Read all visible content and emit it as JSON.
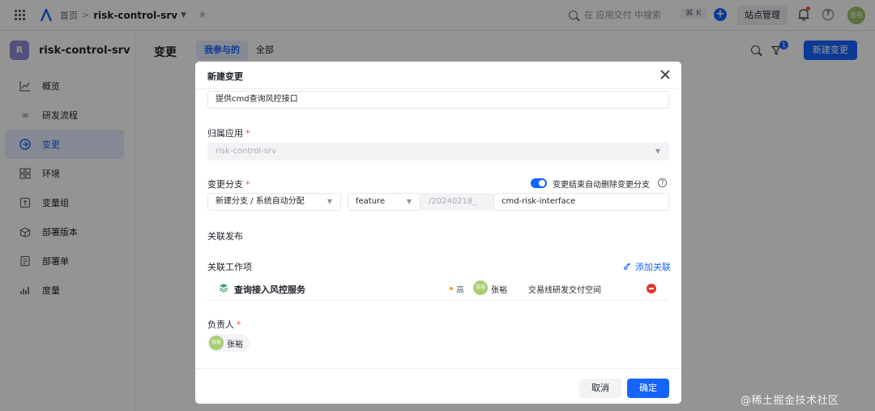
{
  "topbar": {
    "breadcrumb_home": "首页",
    "breadcrumb_sep": ">",
    "app_name": "risk-control-srv",
    "search_placeholder": "在 应用交付 中搜索",
    "shortcut": "⌘ K",
    "site_manage": "站点管理",
    "avatar_text": "张裕"
  },
  "sidebar": {
    "app_badge": "R",
    "app_name": "risk-control-srv",
    "items": [
      {
        "label": "概览",
        "icon": "chart-line-icon"
      },
      {
        "label": "研发流程",
        "icon": "infinity-icon"
      },
      {
        "label": "变更",
        "icon": "change-icon",
        "active": true
      },
      {
        "label": "环境",
        "icon": "grid-icon"
      },
      {
        "label": "变量组",
        "icon": "variable-icon"
      },
      {
        "label": "部署版本",
        "icon": "package-icon"
      },
      {
        "label": "部署单",
        "icon": "document-icon"
      },
      {
        "label": "度量",
        "icon": "bar-chart-icon"
      }
    ]
  },
  "main": {
    "title": "变更",
    "tabs": [
      {
        "label": "我参与的",
        "active": true
      },
      {
        "label": "全部"
      }
    ],
    "filter_count": "1",
    "new_button": "新建变更"
  },
  "modal": {
    "title": "新建变更",
    "name_value": "提供cmd查询风控接口",
    "app_label": "归属应用",
    "app_value": "risk-control-srv",
    "branch_label": "变更分支",
    "auto_delete_label": "变更结束自动删除变更分支",
    "auto_delete_on": true,
    "branch_mode": "新建分支 / 系统自动分配",
    "branch_type": "feature",
    "branch_prefix": "/20240218_",
    "branch_name": "cmd-risk-interface",
    "release_label": "关联发布",
    "work_label": "关联工作项",
    "add_link": "添加关联",
    "work_item": {
      "name": "查询接入风控服务",
      "priority": "高",
      "owner_avatar": "张裕",
      "owner": "张裕",
      "space": "交易线研发交付空间"
    },
    "owner_label": "负责人",
    "required_mark": "*",
    "owner": {
      "avatar": "张裕",
      "name": "张裕"
    },
    "cancel": "取消",
    "confirm": "确定"
  },
  "watermark": "@稀土掘金技术社区",
  "colors": {
    "primary": "#1664ff",
    "danger": "#d83931",
    "priority_high": "#ff9b29"
  }
}
